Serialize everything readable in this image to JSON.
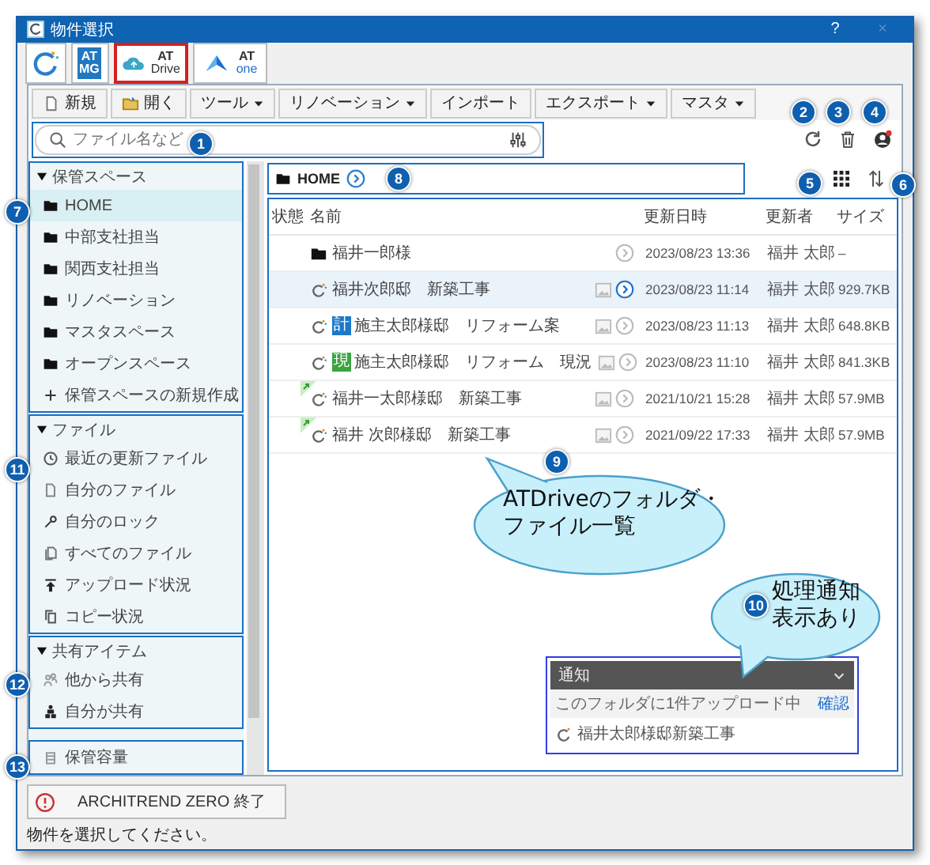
{
  "window": {
    "title": "物件選択",
    "help": "?",
    "close": "×"
  },
  "apps": [
    {
      "kind": "spinner",
      "selected": false
    },
    {
      "kind": "mg",
      "line1": "AT",
      "line2": "MG",
      "selected": false
    },
    {
      "kind": "drive",
      "line1": "AT",
      "line2": "Drive",
      "selected": true
    },
    {
      "kind": "one",
      "line1": "AT",
      "line2": "one",
      "selected": false
    }
  ],
  "toolbar": [
    {
      "label": "新規",
      "kind": "new"
    },
    {
      "label": "開く",
      "kind": "open"
    },
    {
      "label": "ツール",
      "kind": "menu"
    },
    {
      "label": "リノベーション",
      "kind": "menu"
    },
    {
      "label": "インポート",
      "kind": "plain"
    },
    {
      "label": "エクスポート",
      "kind": "menu"
    },
    {
      "label": "マスタ",
      "kind": "menu"
    }
  ],
  "search": {
    "placeholder": "ファイル名など"
  },
  "sidebar": {
    "sections": [
      {
        "title": "保管スペース",
        "expanded": true,
        "items": [
          {
            "label": "HOME",
            "kind": "folder",
            "selected": true
          },
          {
            "label": "中部支社担当",
            "kind": "folder",
            "selected": false
          },
          {
            "label": "関西支社担当",
            "kind": "folder",
            "selected": false
          },
          {
            "label": "リノベーション",
            "kind": "folder",
            "selected": false
          },
          {
            "label": "マスタスペース",
            "kind": "folder",
            "selected": false
          },
          {
            "label": "オープンスペース",
            "kind": "folder",
            "selected": false
          },
          {
            "label": "保管スペースの新規作成",
            "kind": "add",
            "selected": false
          }
        ]
      },
      {
        "title": "ファイル",
        "expanded": true,
        "items": [
          {
            "label": "最近の更新ファイル",
            "kind": "clock",
            "selected": false
          },
          {
            "label": "自分のファイル",
            "kind": "file",
            "selected": false
          },
          {
            "label": "自分のロック",
            "kind": "key",
            "selected": false
          },
          {
            "label": "すべてのファイル",
            "kind": "files",
            "selected": false
          },
          {
            "label": "アップロード状況",
            "kind": "upload",
            "selected": false
          },
          {
            "label": "コピー状況",
            "kind": "copy",
            "selected": false
          }
        ]
      },
      {
        "title": "共有アイテム",
        "expanded": true,
        "items": [
          {
            "label": "他から共有",
            "kind": "people",
            "selected": false
          },
          {
            "label": "自分が共有",
            "kind": "team",
            "selected": false
          }
        ]
      },
      {
        "items": [
          {
            "label": "保管容量",
            "kind": "storage",
            "selected": false
          }
        ]
      }
    ]
  },
  "breadcrumb": {
    "label": "HOME"
  },
  "table": {
    "columns": [
      "状態",
      "名前",
      "更新日時",
      "更新者",
      "サイズ"
    ],
    "rows": [
      {
        "kind": "folder",
        "name": "福井一郎様",
        "thumbnail": false,
        "marked": false,
        "date": "2023/08/23 13:36",
        "updater": "福井 太郎",
        "size": "–",
        "selected": false
      },
      {
        "kind": "drive",
        "name": "福井次郎邸　新築工事",
        "thumbnail": true,
        "marked": false,
        "date": "2023/08/23 11:14",
        "updater": "福井 太郎",
        "size": "929.7KB",
        "selected": true
      },
      {
        "kind": "drive",
        "badge": {
          "text": "計",
          "color": "#1e78c8"
        },
        "name": "施主太郎様邸　リフォーム案",
        "thumbnail": true,
        "marked": false,
        "date": "2023/08/23 11:13",
        "updater": "福井 太郎",
        "size": "648.8KB",
        "selected": false
      },
      {
        "kind": "drive",
        "badge": {
          "text": "現",
          "color": "#3aa540"
        },
        "name": "施主太郎様邸　リフォーム　現況",
        "thumbnail": true,
        "marked": false,
        "date": "2023/08/23 11:10",
        "updater": "福井 太郎",
        "size": "841.3KB",
        "selected": false
      },
      {
        "kind": "drive",
        "name": "福井一太郎様邸　新築工事",
        "thumbnail": true,
        "marked": true,
        "date": "2021/10/21 15:28",
        "updater": "福井 太郎",
        "size": "57.9MB",
        "selected": false
      },
      {
        "kind": "drive",
        "name": "福井 次郎様邸　新築工事",
        "thumbnail": true,
        "marked": true,
        "date": "2021/09/22 17:33",
        "updater": "福井 太郎",
        "size": "57.9MB",
        "selected": false
      }
    ]
  },
  "notification": {
    "title": "通知",
    "message": "このフォルダに1件アップロード中",
    "link": "確認",
    "items": [
      "福井太郎様邸新築工事"
    ]
  },
  "exit_button": "ARCHITREND ZERO 終了",
  "status_bar": "物件を選択してください。",
  "callouts": [
    {
      "number": "1",
      "kind": "marker"
    },
    {
      "number": "2",
      "kind": "marker"
    },
    {
      "number": "3",
      "kind": "marker"
    },
    {
      "number": "4",
      "kind": "marker"
    },
    {
      "number": "5",
      "kind": "marker"
    },
    {
      "number": "6",
      "kind": "marker"
    },
    {
      "number": "7",
      "kind": "marker"
    },
    {
      "number": "8",
      "kind": "marker"
    },
    {
      "number": "9",
      "kind": "bubble",
      "text": [
        "ATDriveのフォルダ・",
        "ファイル一覧"
      ]
    },
    {
      "number": "10",
      "kind": "bubble",
      "text": [
        "処理通知",
        "表示あり"
      ]
    },
    {
      "number": "11",
      "kind": "marker"
    },
    {
      "number": "12",
      "kind": "marker"
    },
    {
      "number": "13",
      "kind": "marker"
    }
  ]
}
